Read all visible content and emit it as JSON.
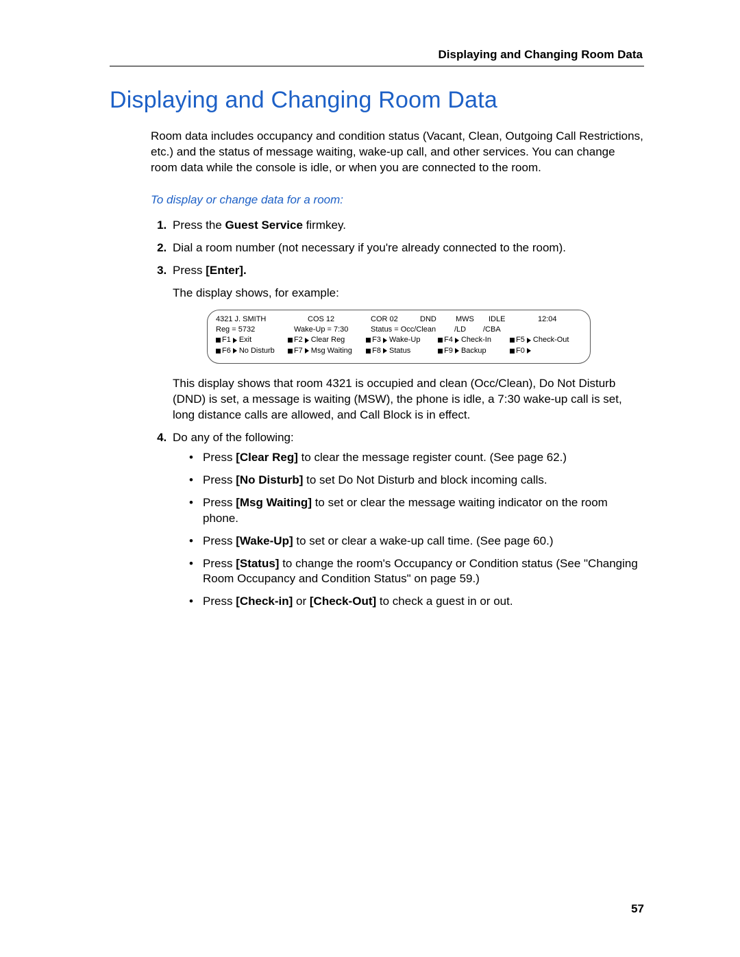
{
  "header": {
    "running_title": "Displaying and Changing Room Data"
  },
  "title": "Displaying and Changing Room Data",
  "intro": "Room data includes occupancy and condition status (Vacant, Clean, Outgoing Call Restrictions, etc.) and the status of message waiting, wake-up call, and other services. You can change room data while the console is idle, or when you are connected to the room.",
  "subhead": "To display or change data for a room:",
  "steps": {
    "s1_a": "Press the ",
    "s1_b": "Guest Service",
    "s1_c": " firmkey.",
    "s2": "Dial a room number (not necessary if you're already connected to the room).",
    "s3_a": "Press ",
    "s3_b": "[Enter].",
    "s3_sub": "The display shows, for example:",
    "s3_after": "This display shows that room 4321 is occupied and clean (Occ/Clean), Do Not Disturb (DND) is set, a message is waiting (MSW), the phone is idle, a 7:30 wake-up call is set, long distance calls are allowed, and Call Block is in effect.",
    "s4": "Do any of the following:"
  },
  "bullets": {
    "b1_a": "Press ",
    "b1_b": "[Clear Reg]",
    "b1_c": " to clear the message register count. (See page 62.)",
    "b2_a": "Press ",
    "b2_b": "[No Disturb]",
    "b2_c": " to set Do Not Disturb and block incoming calls.",
    "b3_a": "Press ",
    "b3_b": "[Msg Waiting]",
    "b3_c": " to set or clear the message waiting indicator on the room phone.",
    "b4_a": "Press ",
    "b4_b": "[Wake-Up]",
    "b4_c": " to set or clear a wake-up call time. (See page 60.)",
    "b5_a": "Press ",
    "b5_b": "[Status]",
    "b5_c": " to change the room's Occupancy or Condition status (See \"Changing Room Occupancy and Condition Status\" on page 59.)",
    "b6_a": "Press ",
    "b6_b": "[Check-in]",
    "b6_c": " or  ",
    "b6_d": "[Check-Out]",
    "b6_e": " to check a guest in or out."
  },
  "console": {
    "line1": {
      "guest": "4321   J. SMITH",
      "cos": "COS 12",
      "cor": "COR 02",
      "dnd": "DND",
      "mws": "MWS",
      "idle": "IDLE",
      "time": "12:04"
    },
    "line2": {
      "reg": "Reg = 5732",
      "wake": "Wake-Up = 7:30",
      "status": "Status = Occ/Clean",
      "ld": "/LD",
      "cba": "/CBA"
    },
    "fkeys_row1": [
      {
        "key": "F1",
        "label": "Exit"
      },
      {
        "key": "F2",
        "label": "Clear Reg"
      },
      {
        "key": "F3",
        "label": "Wake-Up"
      },
      {
        "key": "F4",
        "label": "Check-In"
      },
      {
        "key": "F5",
        "label": "Check-Out"
      }
    ],
    "fkeys_row2": [
      {
        "key": "F6",
        "label": "No Disturb"
      },
      {
        "key": "F7",
        "label": "Msg Waiting"
      },
      {
        "key": "F8",
        "label": "Status"
      },
      {
        "key": "F9",
        "label": "Backup"
      },
      {
        "key": "F0",
        "label": ""
      }
    ]
  },
  "page_number": "57"
}
